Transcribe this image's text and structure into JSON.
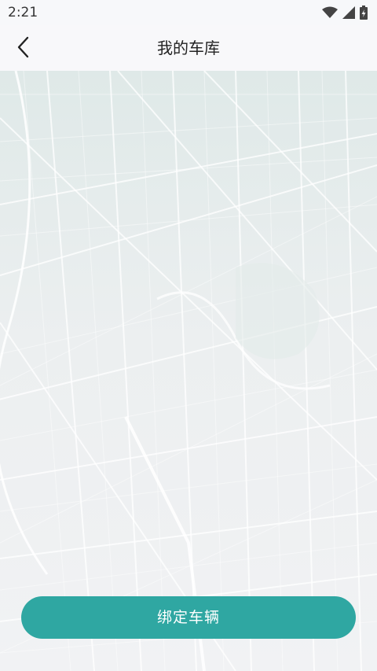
{
  "status_bar": {
    "time": "2:21",
    "icons": [
      "wifi-icon",
      "signal-icon",
      "battery-charging-icon"
    ]
  },
  "header": {
    "back_icon": "chevron-left-icon",
    "title": "我的车库"
  },
  "map": {
    "style": "light-city-map"
  },
  "actions": {
    "bind_vehicle_label": "绑定车辆"
  },
  "colors": {
    "accent": "#2fa7a2",
    "header_bg": "#f8f8fa",
    "title_text": "#222222"
  }
}
